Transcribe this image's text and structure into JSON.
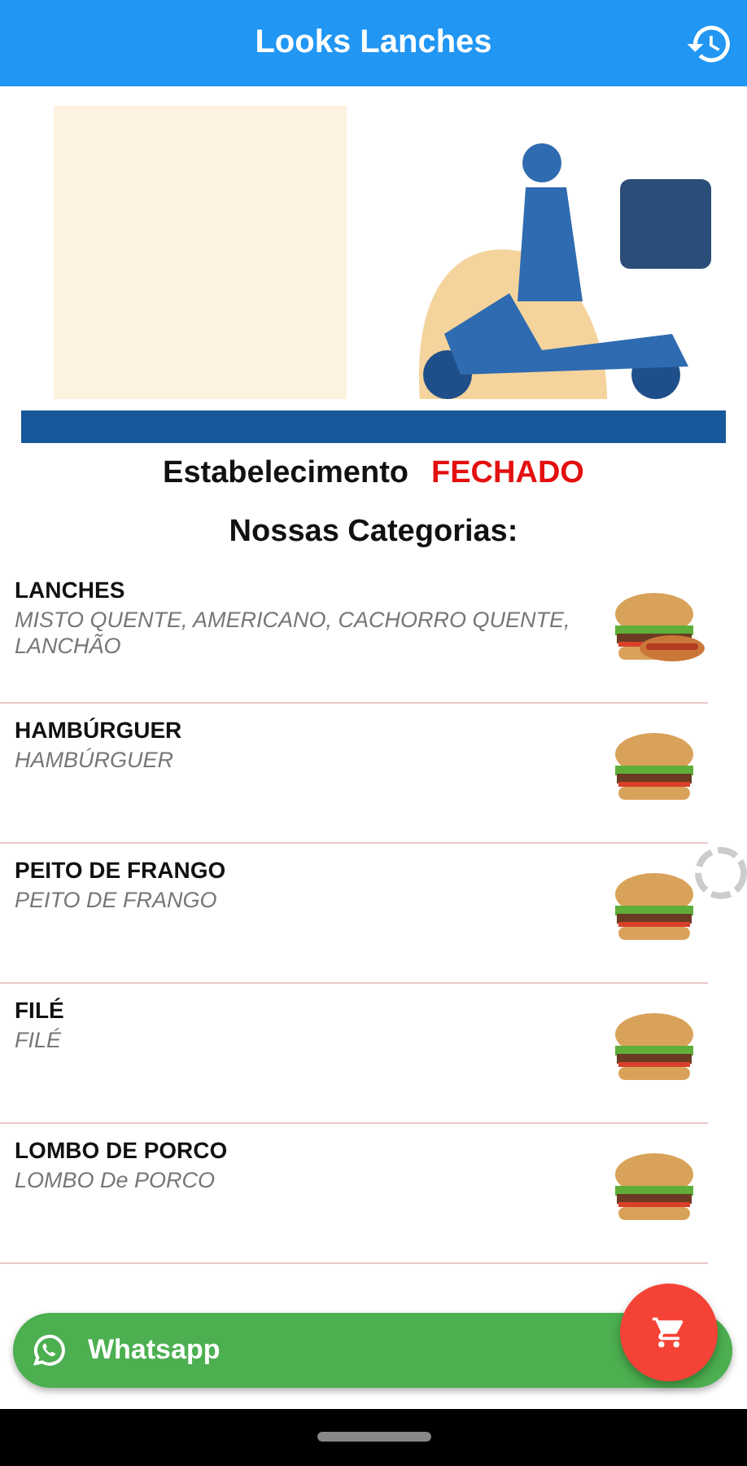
{
  "app_bar": {
    "title": "Looks Lanches"
  },
  "status": {
    "label": "Estabelecimento",
    "value": "FECHADO",
    "open": false
  },
  "section_title": "Nossas Categorias:",
  "categories": [
    {
      "name": "LANCHES",
      "description": "MISTO QUENTE, AMERICANO, CACHORRO QUENTE, LANCHÃO"
    },
    {
      "name": "HAMBÚRGUER",
      "description": "HAMBÚRGUER"
    },
    {
      "name": "PEITO DE FRANGO",
      "description": "PEITO DE FRANGO"
    },
    {
      "name": "FILÉ",
      "description": "FILÉ"
    },
    {
      "name": "LOMBO DE PORCO",
      "description": "LOMBO De PORCO"
    }
  ],
  "whatsapp_button": {
    "label": "Whatsapp"
  }
}
